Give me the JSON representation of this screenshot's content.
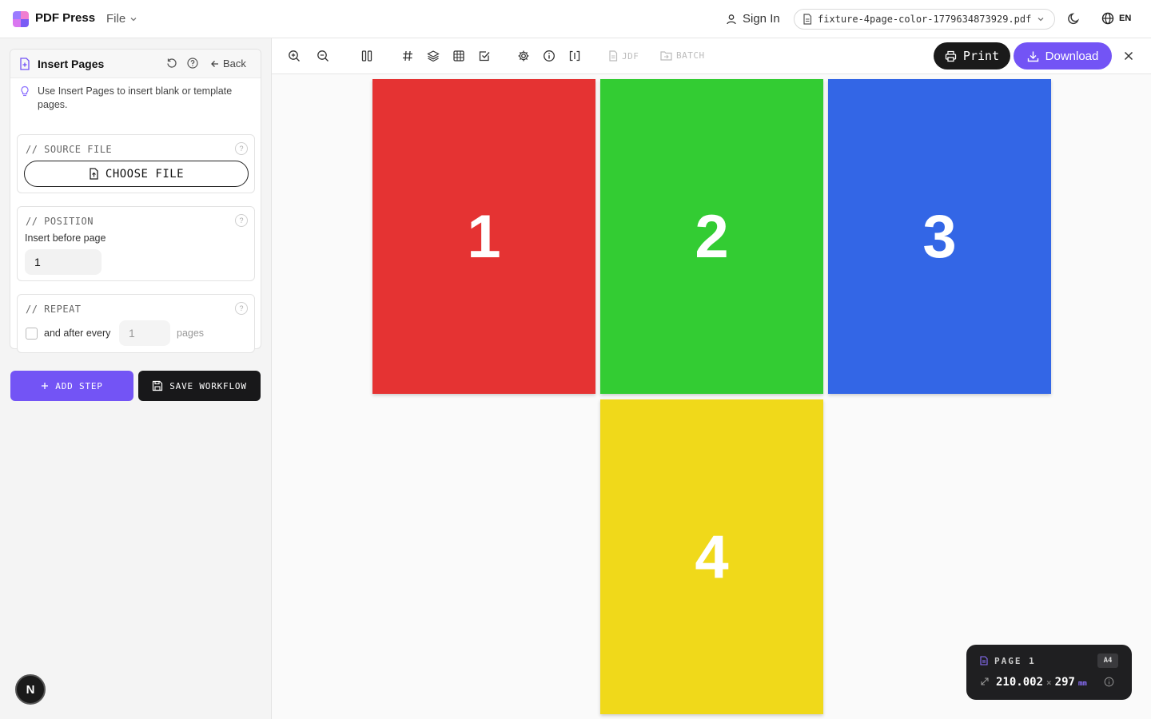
{
  "app": {
    "name": "PDF Press",
    "menu_file": "File"
  },
  "topbar": {
    "signin": "Sign In",
    "filename": "fixture-4page-color-1779634873929.pdf",
    "language": "EN"
  },
  "tool": {
    "title": "Insert Pages",
    "back_label": "Back",
    "tip": "Use Insert Pages to insert blank or template pages.",
    "source_section": "// SOURCE FILE",
    "choose_file": "CHOOSE FILE",
    "position_section": "// POSITION",
    "insert_before_label": "Insert before page",
    "insert_before_value": "1",
    "repeat_section": "// REPEAT",
    "after_every_label": "and after every",
    "after_every_placeholder": "1",
    "pages_label": "pages",
    "help_glyph": "?"
  },
  "actions": {
    "add_step": "ADD STEP",
    "save_workflow": "SAVE WORKFLOW"
  },
  "toolbar": {
    "jdf": "JDF",
    "batch": "BATCH",
    "print": "Print",
    "download": "Download"
  },
  "pages": [
    {
      "number": "1",
      "color": "#e53333"
    },
    {
      "number": "2",
      "color": "#33cc33"
    },
    {
      "number": "3",
      "color": "#3366e6"
    },
    {
      "number": "4",
      "color": "#f0d91a"
    }
  ],
  "page_info": {
    "label": "PAGE 1",
    "size": "A4",
    "width": "210.002",
    "times": "×",
    "height": "297",
    "unit": "mm"
  },
  "badge": "N",
  "colors": {
    "accent": "#7354f5",
    "dark": "#1a1a1a"
  }
}
